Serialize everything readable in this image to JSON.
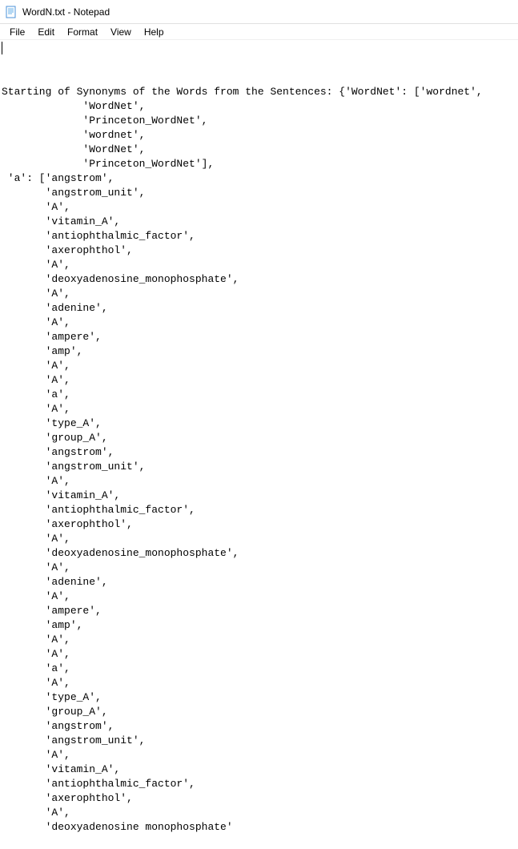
{
  "titlebar": {
    "title": "WordN.txt - Notepad"
  },
  "menubar": {
    "items": [
      "File",
      "Edit",
      "Format",
      "View",
      "Help"
    ]
  },
  "content": {
    "lines": [
      "Starting of Synonyms of the Words from the Sentences: {'WordNet': ['wordnet',",
      "             'WordNet',",
      "             'Princeton_WordNet',",
      "             'wordnet',",
      "             'WordNet',",
      "             'Princeton_WordNet'],",
      " 'a': ['angstrom',",
      "       'angstrom_unit',",
      "       'A',",
      "       'vitamin_A',",
      "       'antiophthalmic_factor',",
      "       'axerophthol',",
      "       'A',",
      "       'deoxyadenosine_monophosphate',",
      "       'A',",
      "       'adenine',",
      "       'A',",
      "       'ampere',",
      "       'amp',",
      "       'A',",
      "       'A',",
      "       'a',",
      "       'A',",
      "       'type_A',",
      "       'group_A',",
      "       'angstrom',",
      "       'angstrom_unit',",
      "       'A',",
      "       'vitamin_A',",
      "       'antiophthalmic_factor',",
      "       'axerophthol',",
      "       'A',",
      "       'deoxyadenosine_monophosphate',",
      "       'A',",
      "       'adenine',",
      "       'A',",
      "       'ampere',",
      "       'amp',",
      "       'A',",
      "       'A',",
      "       'a',",
      "       'A',",
      "       'type_A',",
      "       'group_A',",
      "       'angstrom',",
      "       'angstrom_unit',",
      "       'A',",
      "       'vitamin_A',",
      "       'antiophthalmic_factor',",
      "       'axerophthol',",
      "       'A',",
      "       'deoxyadenosine monophosphate'"
    ]
  }
}
